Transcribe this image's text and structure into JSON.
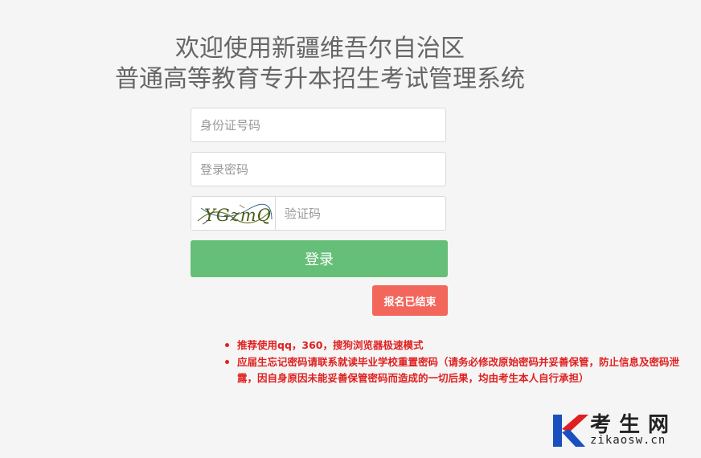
{
  "title": {
    "line1": "欢迎使用新疆维吾尔自治区",
    "line2": "普通高等教育专升本招生考试管理系统"
  },
  "form": {
    "id_placeholder": "身份证号码",
    "password_placeholder": "登录密码",
    "captcha_placeholder": "验证码",
    "captcha_image_text": "YGzmQ",
    "login_label": "登录",
    "closed_label": "报名已结束"
  },
  "notes": [
    "推荐使用qq，360，搜狗浏览器极速模式",
    "应届生忘记密码请联系就读毕业学校重置密码（请务必修改原始密码并妥善保管，防止信息及密码泄露，因自身原因未能妥善保管密码而造成的一切后果，均由考生本人自行承担）"
  ],
  "watermark": {
    "name": "考生网",
    "url": "zikaosw.cn"
  },
  "colors": {
    "login_button": "#66bf78",
    "closed_button": "#f2665b",
    "notes_text": "#e02020",
    "watermark_blue": "#1a4fbf",
    "watermark_red": "#e02020"
  }
}
